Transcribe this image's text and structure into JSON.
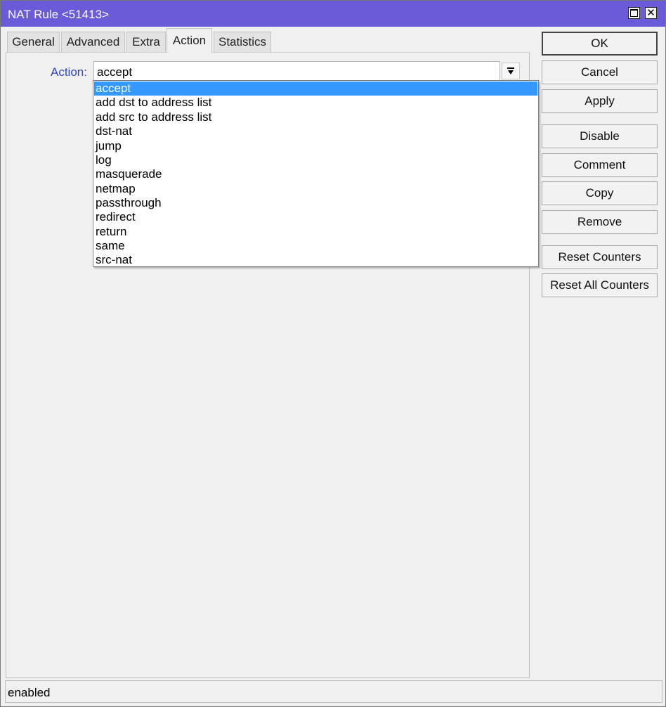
{
  "window": {
    "title": "NAT Rule <51413>",
    "accent_color": "#6a5cd8",
    "controls": {
      "maximize_icon": "maximize-icon",
      "close_icon": "close-icon",
      "close_glyph": "✕"
    }
  },
  "tabs": [
    {
      "label": "General"
    },
    {
      "label": "Advanced"
    },
    {
      "label": "Extra"
    },
    {
      "label": "Action",
      "active": true
    },
    {
      "label": "Statistics"
    }
  ],
  "form": {
    "action_label": "Action:",
    "action_value": "accept",
    "dropdown_arrow_glyph": "🠗",
    "options": [
      "accept",
      "add dst to address list",
      "add src to address list",
      "dst-nat",
      "jump",
      "log",
      "masquerade",
      "netmap",
      "passthrough",
      "redirect",
      "return",
      "same",
      "src-nat"
    ],
    "highlighted_color": "#3399ff"
  },
  "buttons": {
    "ok": "OK",
    "cancel": "Cancel",
    "apply": "Apply",
    "disable": "Disable",
    "comment": "Comment",
    "copy": "Copy",
    "remove": "Remove",
    "reset_counters": "Reset Counters",
    "reset_all_counters": "Reset All Counters"
  },
  "status": {
    "text": "enabled"
  }
}
